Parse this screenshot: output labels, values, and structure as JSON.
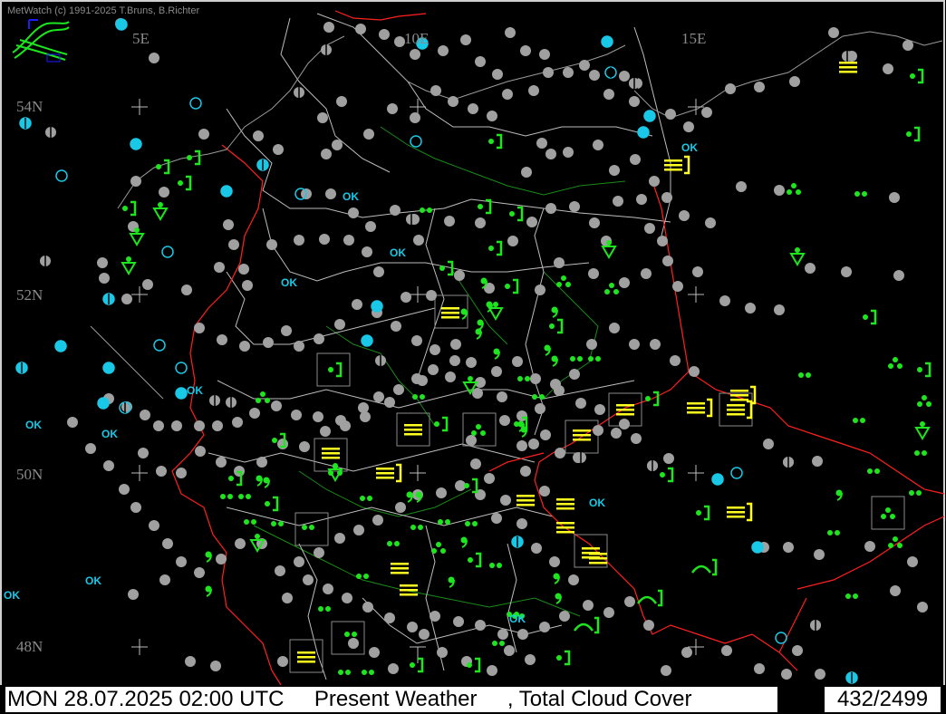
{
  "app": {
    "credit": "MetWatch  (c) 1991-2025 T.Bruns, B.Richter"
  },
  "map": {
    "longitude_labels": [
      "5E",
      "10E",
      "15E"
    ],
    "latitude_labels": [
      "54N",
      "52N",
      "50N",
      "48N"
    ],
    "ok_labels": [
      "OK",
      "OK",
      "OK",
      "OK",
      "OK",
      "OK",
      "OK",
      "OK",
      "OK",
      "OK",
      "OK"
    ],
    "colors": {
      "background": "#000000",
      "border": "#ff2020",
      "region_lines": "#c8c8c8",
      "rivers": "#1a8a1a",
      "cloud_cover_symbol": "#a0a0a0",
      "weather_green": "#1ee61e",
      "weather_yellow": "#ffff20",
      "cyan_station": "#19c8e6"
    }
  },
  "status": {
    "left_text": "MON 28.07.2025 02:00 UTC     Present Weather     , Total Cloud Cover",
    "right_text": "432/2499"
  }
}
